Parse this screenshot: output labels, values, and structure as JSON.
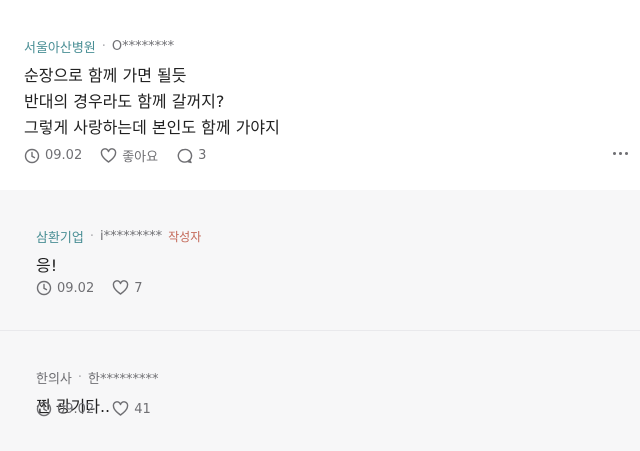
{
  "post": {
    "company": "서울아산병원",
    "user": "O********",
    "lines": [
      "순장으로 함께 가면 될듯",
      "반대의 경우라도 함께 갈꺼지?",
      "그렇게 사랑하는데 본인도 함께 가야지"
    ],
    "date": "09.02",
    "like_label": "좋아요",
    "comment_count": "3"
  },
  "replies": [
    {
      "company": "삼환기업",
      "user": "i*********",
      "author_tag": "작성자",
      "text": "응!",
      "date": "09.02",
      "likes": "7"
    },
    {
      "company": "한의사",
      "user": "한*********",
      "text": "찐 광기다..",
      "date": "09.02",
      "likes": "41"
    }
  ],
  "icons": {
    "clock": "clock-icon",
    "heart": "heart-icon",
    "comment": "comment-bubble-icon",
    "more": "more-dots-icon"
  },
  "colors": {
    "company": "#4a8f95",
    "author_tag": "#c46a5a",
    "muted": "#6f6f73"
  }
}
